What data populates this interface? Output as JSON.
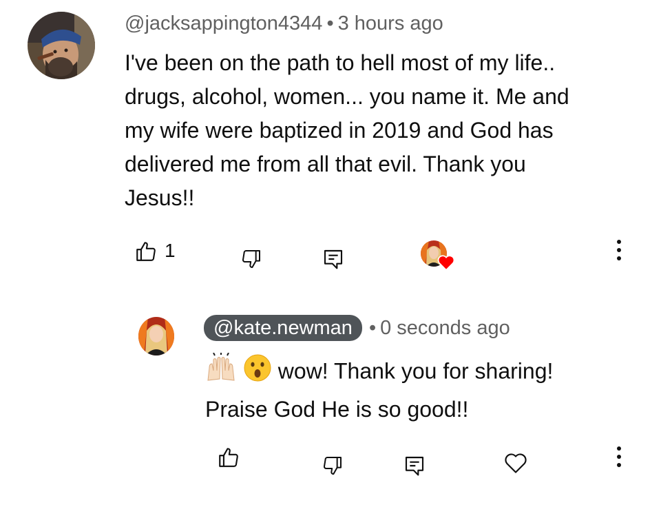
{
  "top_comment": {
    "handle": "@jacksappington4344",
    "separator": "•",
    "time": "3 hours ago",
    "lines": [
      "I've been on the path to hell most of my life..",
      "drugs, alcohol, women... you name it. Me and",
      "my wife were baptized in 2019 and God has",
      "delivered me from all that evil. Thank you",
      "Jesus!!"
    ],
    "like_count": "1",
    "icons": {
      "like": "thumbs-up-icon",
      "dislike": "thumbs-down-icon",
      "reply": "reply-icon",
      "creator_heart": "creator-heart-avatar",
      "more": "more-vertical-icon"
    }
  },
  "reply_comment": {
    "handle": "@kate.newman",
    "separator": "•",
    "time": "0 seconds ago",
    "line1_text": "wow! Thank you for sharing!",
    "line2": "Praise God He is so good!!",
    "emojis": [
      "raising-hands-emoji",
      "astonished-face-emoji"
    ],
    "icons": {
      "like": "thumbs-up-icon",
      "dislike": "thumbs-down-icon",
      "reply": "reply-icon",
      "heart": "heart-outline-icon",
      "more": "more-vertical-icon"
    }
  },
  "colors": {
    "text": "#0f0f0f",
    "meta": "#606060",
    "pill": "#4f5458",
    "heart_red": "#ff0000"
  }
}
